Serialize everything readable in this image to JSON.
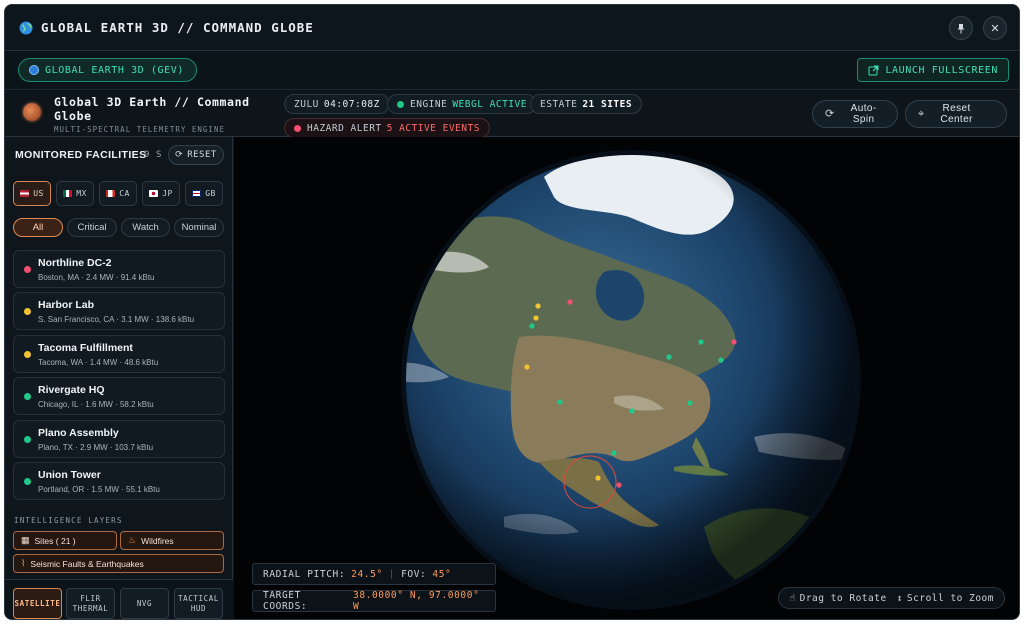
{
  "window": {
    "title": "GLOBAL EARTH 3D // COMMAND GLOBE",
    "pin_icon": "pin-icon",
    "close_label": "✕"
  },
  "toolbar": {
    "app_pill": "GLOBAL EARTH 3D (GEV)",
    "launch_label": "LAUNCH FULLSCREEN"
  },
  "header": {
    "title": "Global 3D Earth // Command Globe",
    "subtitle": "MULTI-SPECTRAL TELEMETRY ENGINE",
    "zulu_label": "ZULU",
    "zulu_time": "04:07:08Z",
    "engine_label": "ENGINE",
    "engine_value": "WEBGL ACTIVE",
    "estate_label": "ESTATE",
    "estate_value": "21 SITES",
    "hazard_label": "HAZARD ALERT",
    "hazard_value": "5 ACTIVE EVENTS",
    "autospin_label": "Auto-Spin",
    "reset_center_label": "Reset Center"
  },
  "sidebar": {
    "title": "MONITORED FACILITIES",
    "count": "9 S",
    "reset_label": "RESET",
    "countries": [
      {
        "code": "US",
        "active": true
      },
      {
        "code": "MX",
        "active": false
      },
      {
        "code": "CA",
        "active": false
      },
      {
        "code": "JP",
        "active": false
      },
      {
        "code": "GB",
        "active": false
      }
    ],
    "filters": [
      {
        "label": "All",
        "active": true
      },
      {
        "label": "Critical",
        "active": false
      },
      {
        "label": "Watch",
        "active": false
      },
      {
        "label": "Nominal",
        "active": false
      }
    ],
    "facilities": [
      {
        "name": "Northline DC-2",
        "meta": "Boston, MA · 2.4 MW · 91.4 kBtu",
        "status": "critical"
      },
      {
        "name": "Harbor Lab",
        "meta": "S. San Francisco, CA · 3.1 MW · 138.6 kBtu",
        "status": "watch"
      },
      {
        "name": "Tacoma Fulfillment",
        "meta": "Tacoma, WA · 1.4 MW · 48.6 kBtu",
        "status": "watch"
      },
      {
        "name": "Rivergate HQ",
        "meta": "Chicago, IL · 1.6 MW · 58.2 kBtu",
        "status": "nominal"
      },
      {
        "name": "Plano Assembly",
        "meta": "Plano, TX · 2.9 MW · 103.7 kBtu",
        "status": "nominal"
      },
      {
        "name": "Union Tower",
        "meta": "Portland, OR · 1.5 MW · 55.1 kBtu",
        "status": "nominal"
      }
    ],
    "layers_title": "INTELLIGENCE LAYERS",
    "layers": {
      "sites": "Sites ( 21 )",
      "wildfires": "Wildfires",
      "seismic": "Seismic Faults & Earthquakes"
    },
    "view_modes": [
      "SATELLITE",
      "FLIR THERMAL",
      "NVG",
      "TACTICAL HUD"
    ]
  },
  "colors": {
    "critical": "#f0506e",
    "watch": "#f2c230",
    "nominal": "#1fc98a",
    "accent": "#3fe0b6",
    "highlight": "#ff9a5a"
  },
  "globe": {
    "pitch_label": "RADIAL PITCH:",
    "pitch_value": "24.5°",
    "fov_label": "FOV:",
    "fov_value": "45°",
    "coords_label": "TARGET COORDS:",
    "coords_value": "38.0000° N, 97.0000° W",
    "hint_rotate": "Drag to Rotate",
    "hint_zoom": "Scroll to Zoom"
  }
}
